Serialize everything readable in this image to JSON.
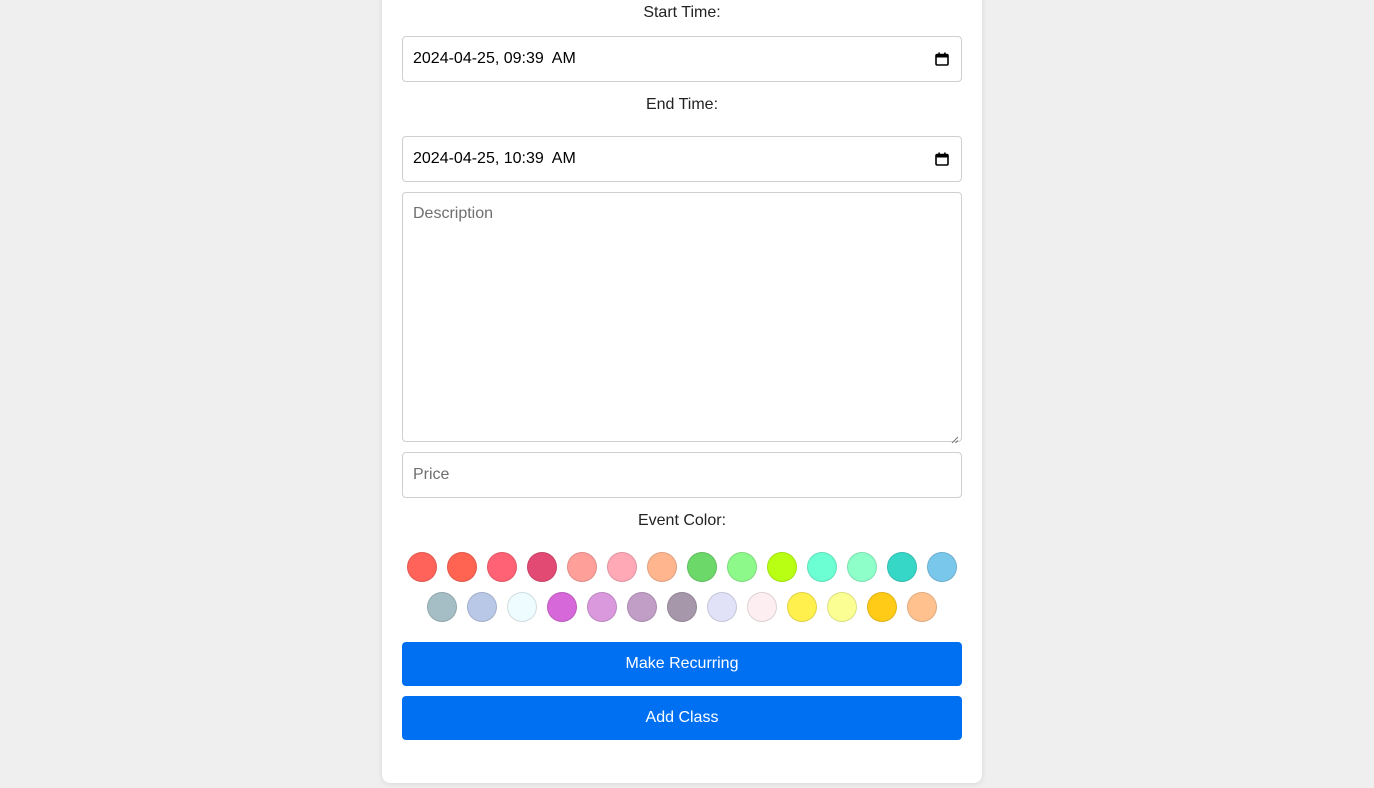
{
  "form": {
    "start_label": "Start Time:",
    "start_value": "2024-04-25, 09:39  AM",
    "end_label": "End Time:",
    "end_value": "2024-04-25, 10:39  AM",
    "description_placeholder": "Description",
    "price_placeholder": "Price",
    "color_label": "Event Color:",
    "colors": [
      "#ff6359",
      "#ff6352",
      "#ff6274",
      "#e24a74",
      "#ff9f9a",
      "#ffa9b6",
      "#ffb68f",
      "#6cd86a",
      "#8ef98b",
      "#b9ff13",
      "#6dffd4",
      "#8effc8",
      "#37d7c8",
      "#7ac7ec",
      "#a5bdc5",
      "#b8c8e6",
      "#eefcff",
      "#d768d9",
      "#d999dc",
      "#c19ec6",
      "#a697aa",
      "#e1e2f8",
      "#fdeef1",
      "#fff04e",
      "#fbff93",
      "#ffcb17",
      "#ffc28f"
    ],
    "recurring_label": "Make Recurring",
    "submit_label": "Add Class"
  },
  "icons": {
    "start_calendar": "calendar-icon",
    "end_calendar": "calendar-icon"
  }
}
